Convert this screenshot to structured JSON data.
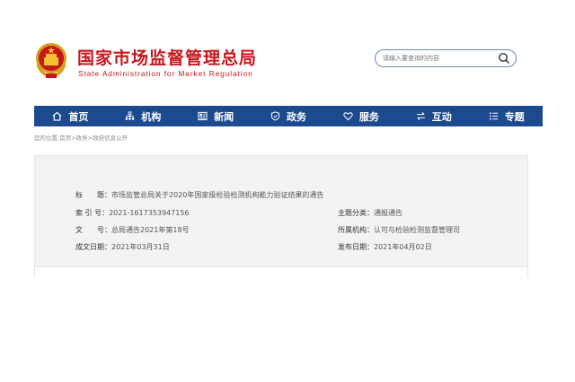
{
  "site": {
    "name_cn": "国家市场监督管理总局",
    "name_en": "State Administration for Market Regulation"
  },
  "search": {
    "placeholder": "请输入要查询的内容"
  },
  "nav": [
    {
      "label": "首页",
      "icon": "home-icon"
    },
    {
      "label": "机构",
      "icon": "org-chart-icon"
    },
    {
      "label": "新闻",
      "icon": "newspaper-icon"
    },
    {
      "label": "政务",
      "icon": "shield-icon"
    },
    {
      "label": "服务",
      "icon": "heart-icon"
    },
    {
      "label": "互动",
      "icon": "exchange-icon"
    },
    {
      "label": "专题",
      "icon": "list-icon"
    }
  ],
  "breadcrumb": {
    "prefix": "您的位置:",
    "items": [
      "首页",
      "政务",
      "政府信息公开"
    ],
    "separator": ">"
  },
  "info": {
    "title_label": "标　　题：",
    "title_value": "市场监管总局关于2020年国家级检验检测机构能力验证结果的通告",
    "index_label": "索 引 号：",
    "index_value": "2021-1617353947156",
    "category_label": "主题分类：",
    "category_value": "通报通告",
    "doc_label": "文　　号：",
    "doc_value": "总局通告2021年第18号",
    "agency_label": "所属机构：",
    "agency_value": "认可与检验检测监督管理司",
    "created_label": "成文日期：",
    "created_value": "2021年03月31日",
    "published_label": "发布日期：",
    "published_value": "2021年04月02日"
  },
  "colors": {
    "brand_red": "#c8161d",
    "nav_blue": "#1b4a8f"
  }
}
